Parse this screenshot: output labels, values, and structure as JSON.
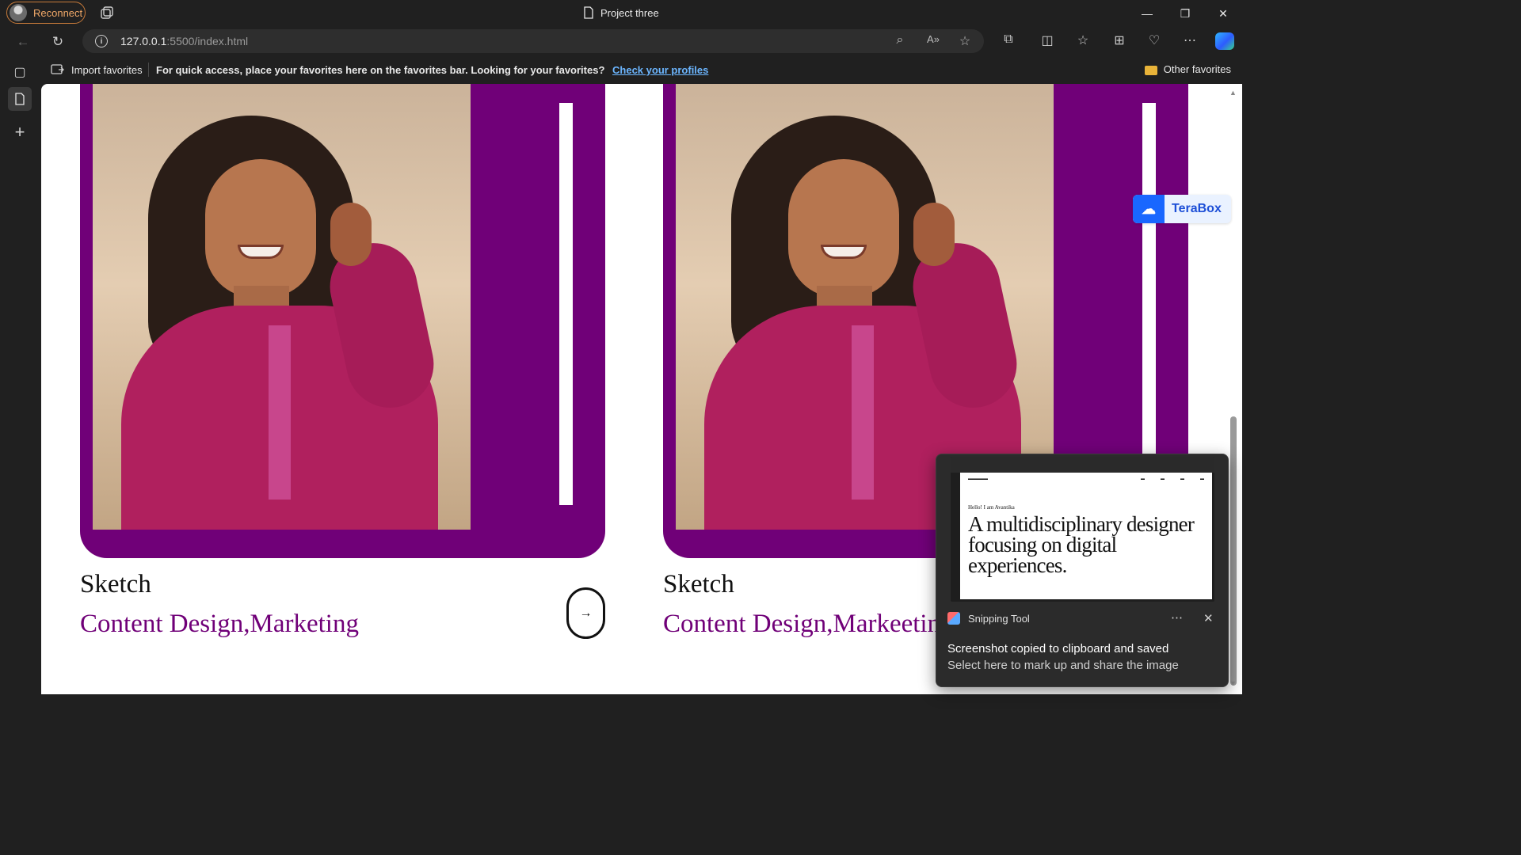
{
  "browser": {
    "profile_label": "Reconnect",
    "window_title": "Project three",
    "url_host": "127.0.0.1",
    "url_rest": ":5500/index.html",
    "favorites": {
      "import_label": "Import favorites",
      "message": "For quick access, place your favorites here on the favorites bar. Looking for your favorites?",
      "link": "Check your profiles",
      "other": "Other favorites"
    }
  },
  "page": {
    "accent_color": "#700078",
    "cards": [
      {
        "title": "Sketch",
        "subtitle": "Content Design,Marketing",
        "arrow": "→"
      },
      {
        "title": "Sketch",
        "subtitle": "Content Design,Markeeting"
      }
    ]
  },
  "terabox": {
    "label": "TeraBox"
  },
  "snipping_toast": {
    "app_name": "Snipping Tool",
    "message": "Screenshot copied to clipboard and saved",
    "submessage": "Select here to mark up and share the image",
    "preview": {
      "hello": "Hello! I am Avantika",
      "headline": "A multidisciplinary designer focusing on digital experiences."
    }
  }
}
